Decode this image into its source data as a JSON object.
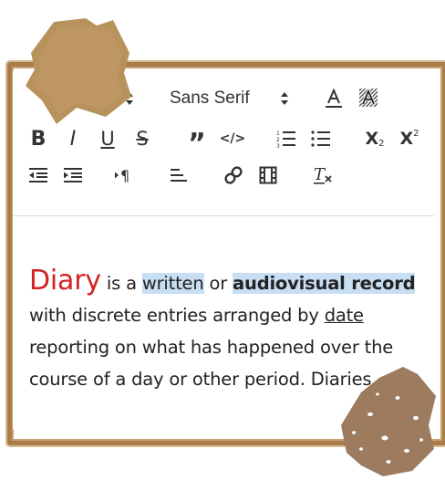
{
  "toolbar": {
    "font_family": "Sans Serif",
    "icons": {
      "header_dropdown": "dropdown-arrows-icon",
      "font_dropdown": "dropdown-arrows-icon",
      "text_color": "font-color-icon",
      "background_color": "background-color-icon",
      "bold": "B",
      "italic": "I",
      "underline": "U",
      "strike": "S",
      "blockquote": "”",
      "code": "</>",
      "ordered_list": "ordered-list-icon",
      "bullet_list": "bullet-list-icon",
      "subscript": "X",
      "superscript": "X",
      "subscript_index": "2",
      "superscript_index": "2",
      "outdent": "outdent-icon",
      "indent": "indent-icon",
      "direction": "text-direction-icon",
      "align": "align-icon",
      "link": "link-icon",
      "video": "video-icon",
      "clean": "clear-format-icon"
    }
  },
  "content": {
    "w1": "Diary",
    "w2": " is a ",
    "w3": "written",
    "w4": " or ",
    "w5": "audiovisual record",
    "w6": " with discrete entries arranged by ",
    "w7": "date",
    "w8": " reporting on what has happened over the course of a day or other period. Diaries"
  },
  "colors": {
    "frame": "#a97c4c",
    "patch": "#b8925d",
    "accent_red": "#d32323",
    "highlight": "#c8def3"
  }
}
